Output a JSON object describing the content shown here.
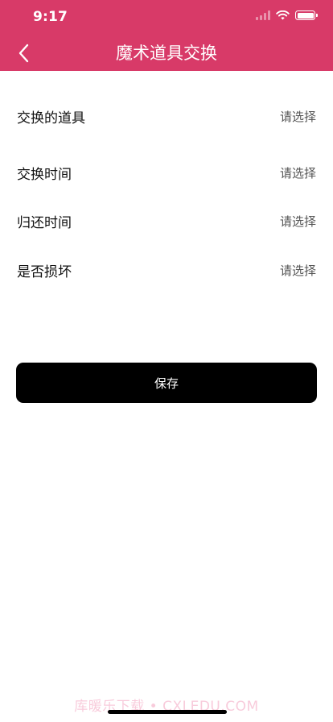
{
  "status_bar": {
    "time": "9:17"
  },
  "nav": {
    "title": "魔术道具交换",
    "back_icon": "chevron-left-icon"
  },
  "form": {
    "rows": [
      {
        "label": "交换的道具",
        "value": "请选择"
      },
      {
        "label": "交换时间",
        "value": "请选择"
      },
      {
        "label": "归还时间",
        "value": "请选择"
      },
      {
        "label": "是否损坏",
        "value": "请选择"
      }
    ]
  },
  "actions": {
    "save_label": "保存"
  },
  "watermark": {
    "text": "库暖乐下载 • CXLEDU.COM"
  },
  "colors": {
    "header_bg": "#d83a68",
    "button_bg": "#000000",
    "button_text": "#ffffff"
  }
}
